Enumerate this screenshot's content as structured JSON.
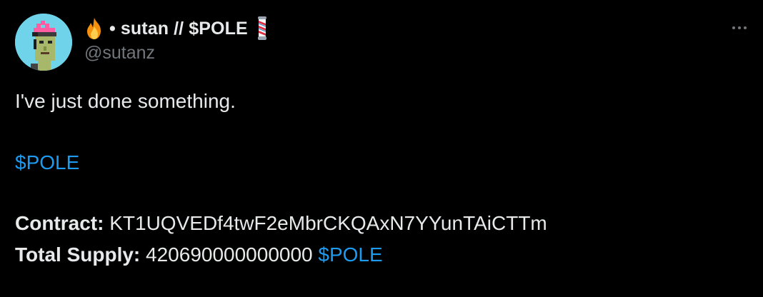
{
  "author": {
    "display_name": "• sutan // $POLE",
    "handle": "@sutanz",
    "name_icons": [
      "fire-emoji",
      "barber-pole-emoji"
    ]
  },
  "actions": {
    "more_icon": "more-horizontal-icon"
  },
  "tweet": {
    "line1": "I've just done something.",
    "cashtag1": "$POLE",
    "contract_label": "Contract:",
    "contract_value": "KT1UQVEDf4twF2eMbrCKQAxN7YYunTAiCTTm",
    "supply_label": "Total Supply:",
    "supply_value": "420690000000000",
    "supply_cashtag": "$POLE"
  },
  "colors": {
    "background": "#000000",
    "text_primary": "#e7e9ea",
    "text_secondary": "#71767b",
    "link": "#1d9bf0"
  }
}
